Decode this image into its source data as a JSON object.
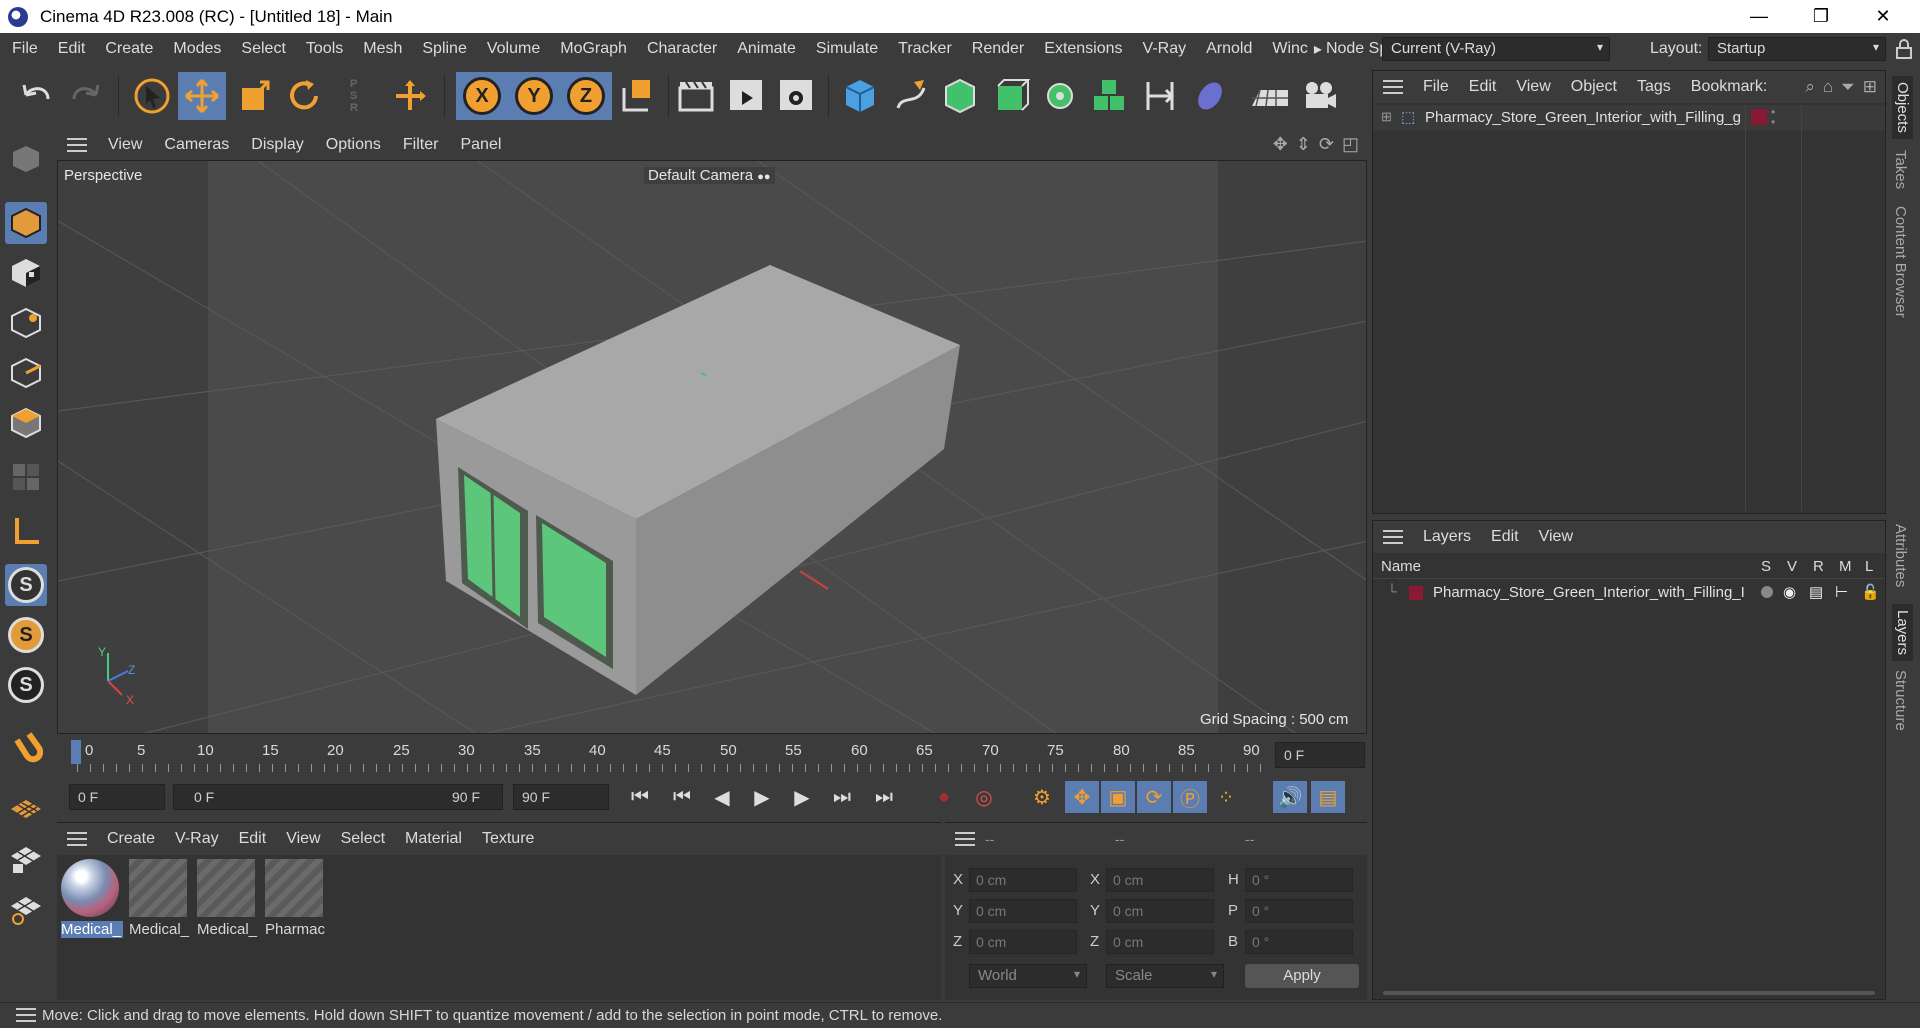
{
  "window": {
    "title": "Cinema 4D R23.008 (RC) - [Untitled 18] - Main",
    "controls": {
      "minimize": "—",
      "maximize": "❐",
      "close": "✕"
    }
  },
  "menubar": {
    "items": [
      "File",
      "Edit",
      "Create",
      "Modes",
      "Select",
      "Tools",
      "Mesh",
      "Spline",
      "Volume",
      "MoGraph",
      "Character",
      "Animate",
      "Simulate",
      "Tracker",
      "Render",
      "Extensions",
      "V-Ray",
      "Arnold",
      "Winc"
    ],
    "overflow_arrow": "▸",
    "node_space_label": "Node Space:",
    "node_space_value": "Current (V-Ray)",
    "layout_label": "Layout:",
    "layout_value": "Startup"
  },
  "viewport": {
    "menu": [
      "View",
      "Cameras",
      "Display",
      "Options",
      "Filter",
      "Panel"
    ],
    "view_name": "Perspective",
    "camera": "Default Camera",
    "grid_spacing": "Grid Spacing : 500 cm",
    "axis_labels": {
      "x": "X",
      "y": "Y",
      "z": "Z"
    }
  },
  "timeline": {
    "ticks": [
      "0",
      "5",
      "10",
      "15",
      "20",
      "25",
      "30",
      "35",
      "40",
      "45",
      "50",
      "55",
      "60",
      "65",
      "70",
      "75",
      "80",
      "85",
      "90"
    ],
    "current_frame": "0 F"
  },
  "transport": {
    "start_field": "0 F",
    "range_start": "0 F",
    "range_end": "90 F",
    "end_field": "90 F"
  },
  "materials": {
    "menu": [
      "Create",
      "V-Ray",
      "Edit",
      "View",
      "Select",
      "Material",
      "Texture"
    ],
    "items": [
      "Medical_",
      "Medical_",
      "Medical_",
      "Pharmac"
    ]
  },
  "coordinates": {
    "headers": [
      "--",
      "--",
      "--"
    ],
    "rows": [
      {
        "a": "X",
        "av": "0 cm",
        "b": "X",
        "bv": "0 cm",
        "c": "H",
        "cv": "0 °"
      },
      {
        "a": "Y",
        "av": "0 cm",
        "b": "Y",
        "bv": "0 cm",
        "c": "P",
        "cv": "0 °"
      },
      {
        "a": "Z",
        "av": "0 cm",
        "b": "Z",
        "bv": "0 cm",
        "c": "B",
        "cv": "0 °"
      }
    ],
    "mode": "World",
    "scale": "Scale",
    "apply": "Apply"
  },
  "objects": {
    "menu": [
      "File",
      "Edit",
      "View",
      "Object",
      "Tags",
      "Bookmark:"
    ],
    "item": "Pharmacy_Store_Green_Interior_with_Filling_g",
    "tag_color": "#8a1a33"
  },
  "layers": {
    "menu": [
      "Layers",
      "Edit",
      "View"
    ],
    "columns": {
      "name": "Name",
      "s": "S",
      "v": "V",
      "r": "R",
      "m": "M",
      "l": "L"
    },
    "item": "Pharmacy_Store_Green_Interior_with_Filling_I"
  },
  "side_tabs": [
    "Objects",
    "Takes",
    "Content Browser",
    "Attributes",
    "Layers",
    "Structure"
  ],
  "status": "Move: Click and drag to move elements. Hold down SHIFT to quantize movement / add to the selection in point mode, CTRL to remove.",
  "colors": {
    "accent": "#5b7db2",
    "panel": "#333333",
    "window_green": "#5cc77a"
  }
}
